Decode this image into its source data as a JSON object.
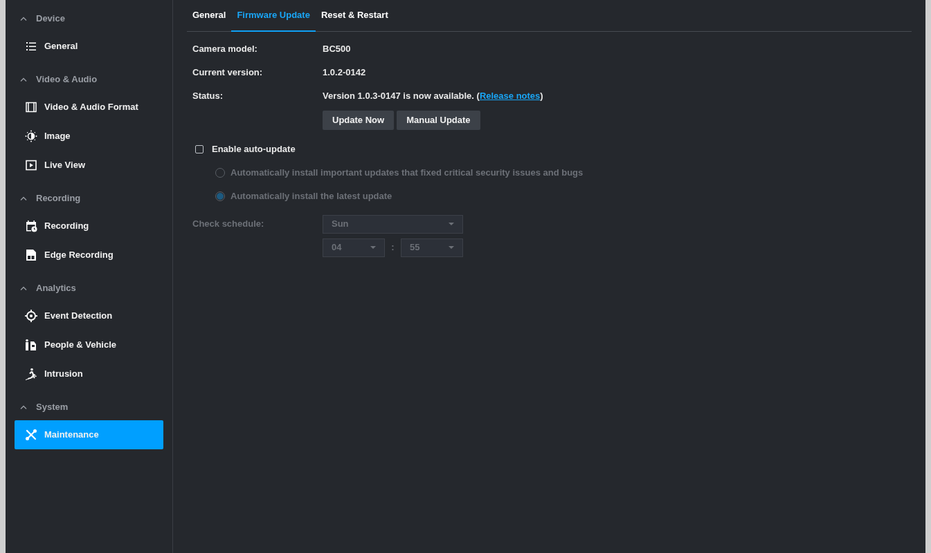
{
  "sidebar": {
    "sections": [
      {
        "title": "Device",
        "expanded": true,
        "items": [
          {
            "label": "General",
            "selected": false
          }
        ]
      },
      {
        "title": "Video & Audio",
        "expanded": true,
        "items": [
          {
            "label": "Video & Audio Format",
            "selected": false
          },
          {
            "label": "Image",
            "selected": false
          },
          {
            "label": "Live View",
            "selected": false
          }
        ]
      },
      {
        "title": "Recording",
        "expanded": true,
        "items": [
          {
            "label": "Recording",
            "selected": false
          },
          {
            "label": "Edge Recording",
            "selected": false
          }
        ]
      },
      {
        "title": "Analytics",
        "expanded": true,
        "items": [
          {
            "label": "Event Detection",
            "selected": false
          },
          {
            "label": "People & Vehicle",
            "selected": false
          },
          {
            "label": "Intrusion",
            "selected": false
          }
        ]
      },
      {
        "title": "System",
        "expanded": true,
        "items": [
          {
            "label": "Maintenance",
            "selected": true
          }
        ]
      }
    ]
  },
  "tabs": [
    {
      "label": "General",
      "selected": false
    },
    {
      "label": "Firmware Update",
      "selected": true
    },
    {
      "label": "Reset & Restart",
      "selected": false
    }
  ],
  "info": [
    {
      "label": "Camera model:",
      "value": "BC500"
    },
    {
      "label": "Current version:",
      "value": "1.0.2-0142"
    }
  ],
  "status": {
    "label": "Status:",
    "text": "Version 1.0.3-0147 is now available. (",
    "link": "Release notes",
    "suffix": ")"
  },
  "buttons": [
    "Update Now",
    "Manual Update"
  ],
  "auto_update": {
    "label": "Enable auto-update",
    "checked": false
  },
  "options": [
    {
      "label": "Automatically install important updates that fixed critical security issues and bugs",
      "selected": false,
      "disabled": true
    },
    {
      "label": "Automatically install the latest update",
      "selected": true,
      "disabled": true
    }
  ],
  "schedule": {
    "label": "Check schedule:",
    "disabled": true,
    "day": "Sun",
    "hour": "04",
    "separator": ":",
    "minute": "55"
  }
}
